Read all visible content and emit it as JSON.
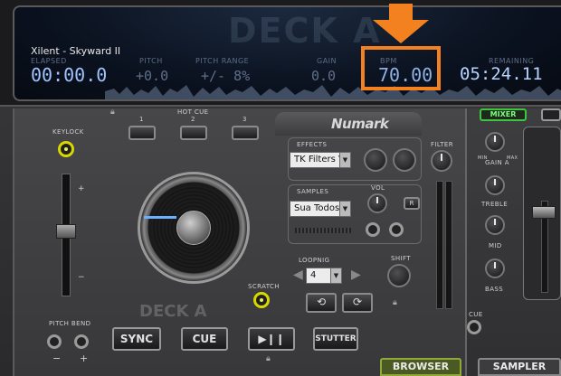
{
  "display": {
    "watermark": "DECK A",
    "track_title": "Xilent - Skyward II",
    "elapsed_label": "ELAPSED",
    "elapsed_value": "00:00.0",
    "pitch_label": "PITCH",
    "pitch_value": "+0.0",
    "pitch_range_label": "PITCH RANGE",
    "pitch_range_value": "+/- 8%",
    "gain_label": "GAIN",
    "gain_value": "0.0",
    "bpm_label": "BPM",
    "bpm_value": "70.00",
    "remaining_label": "REMAINING",
    "remaining_value": "05:24.11"
  },
  "deck": {
    "keylock_label": "KEYLOCK",
    "hot_cue_label": "HOT CUE",
    "hot_cue_buttons": [
      "1",
      "2",
      "3"
    ],
    "brand": "Numark",
    "effects_label": "EFFECTS",
    "effects_selected": "TK Filters V",
    "filter_label": "FILTER",
    "samples_label": "SAMPLES",
    "samples_selected": "Sua Todos",
    "vol_label": "VOL",
    "r_label": "R",
    "looping_label": "LOOPNIG",
    "loop_selected": "4",
    "shift_label": "SHIFT",
    "scratch_label": "SCRATCH",
    "pitch_bend_label": "PITCH BEND",
    "pitch_minus": "−",
    "pitch_plus": "+",
    "slider_plus": "+",
    "slider_minus": "−",
    "deck_label": "DECK A",
    "sync_label": "SYNC",
    "cue_label": "CUE",
    "play_pause_label": "▶❙❙",
    "stutter_label": "STUTTER",
    "cue_mixer_label": "CUE"
  },
  "mixer": {
    "tab_label": "MIXER",
    "gain_label": "GAIN A",
    "treble_label": "TREBLE",
    "mid_label": "MID",
    "bass_label": "BASS",
    "min_label": "MIN",
    "max_label": "MAX"
  },
  "bottom_tabs": {
    "browser": "BROWSER",
    "sampler": "SAMPLER"
  },
  "colors": {
    "accent_orange": "#f4811f",
    "display_text": "#9ec4ff",
    "mixer_green": "#3ec43e",
    "led_yellow": "#d8d800"
  }
}
